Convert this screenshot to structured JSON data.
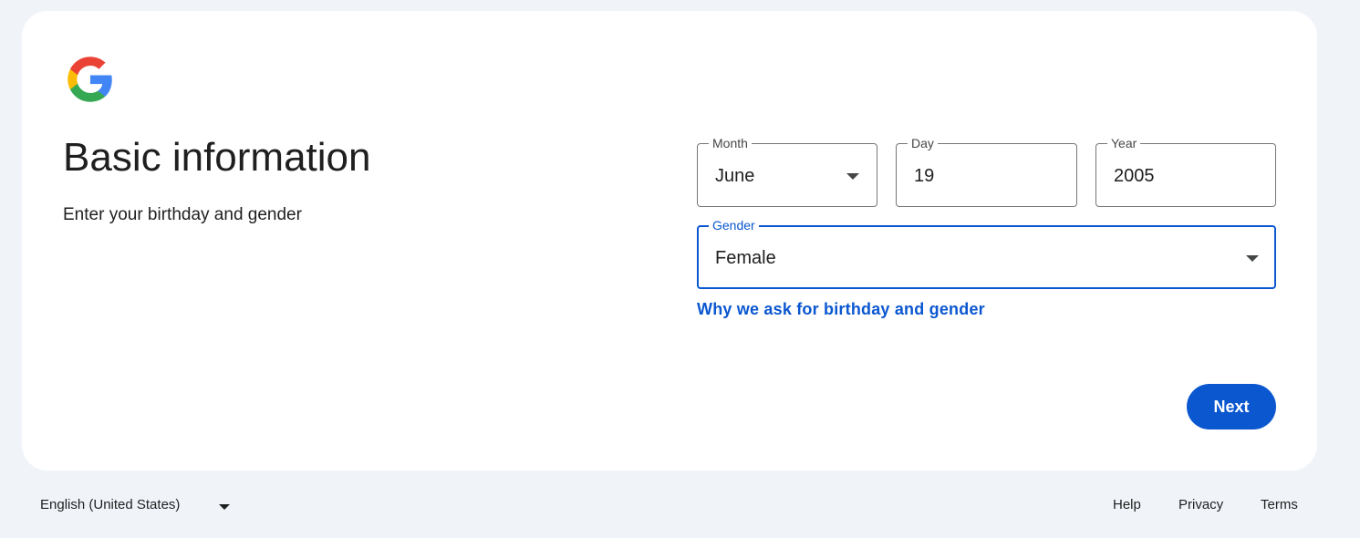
{
  "page": {
    "title": "Basic information",
    "subtitle": "Enter your birthday and gender"
  },
  "logo": {
    "icon": "google-g-logo"
  },
  "fields": {
    "month": {
      "label": "Month",
      "value": "June",
      "icon": "dropdown-caret-icon"
    },
    "day": {
      "label": "Day",
      "value": "19"
    },
    "year": {
      "label": "Year",
      "value": "2005"
    },
    "gender": {
      "label": "Gender",
      "value": "Female",
      "icon": "dropdown-caret-icon"
    }
  },
  "links": {
    "why": "Why we ask for birthday and gender"
  },
  "buttons": {
    "next": "Next"
  },
  "footer": {
    "language": "English (United States)",
    "help": "Help",
    "privacy": "Privacy",
    "terms": "Terms"
  },
  "colors": {
    "accent": "#0b57d0",
    "background": "#f0f4f9",
    "card": "#ffffff",
    "border": "#747775"
  }
}
